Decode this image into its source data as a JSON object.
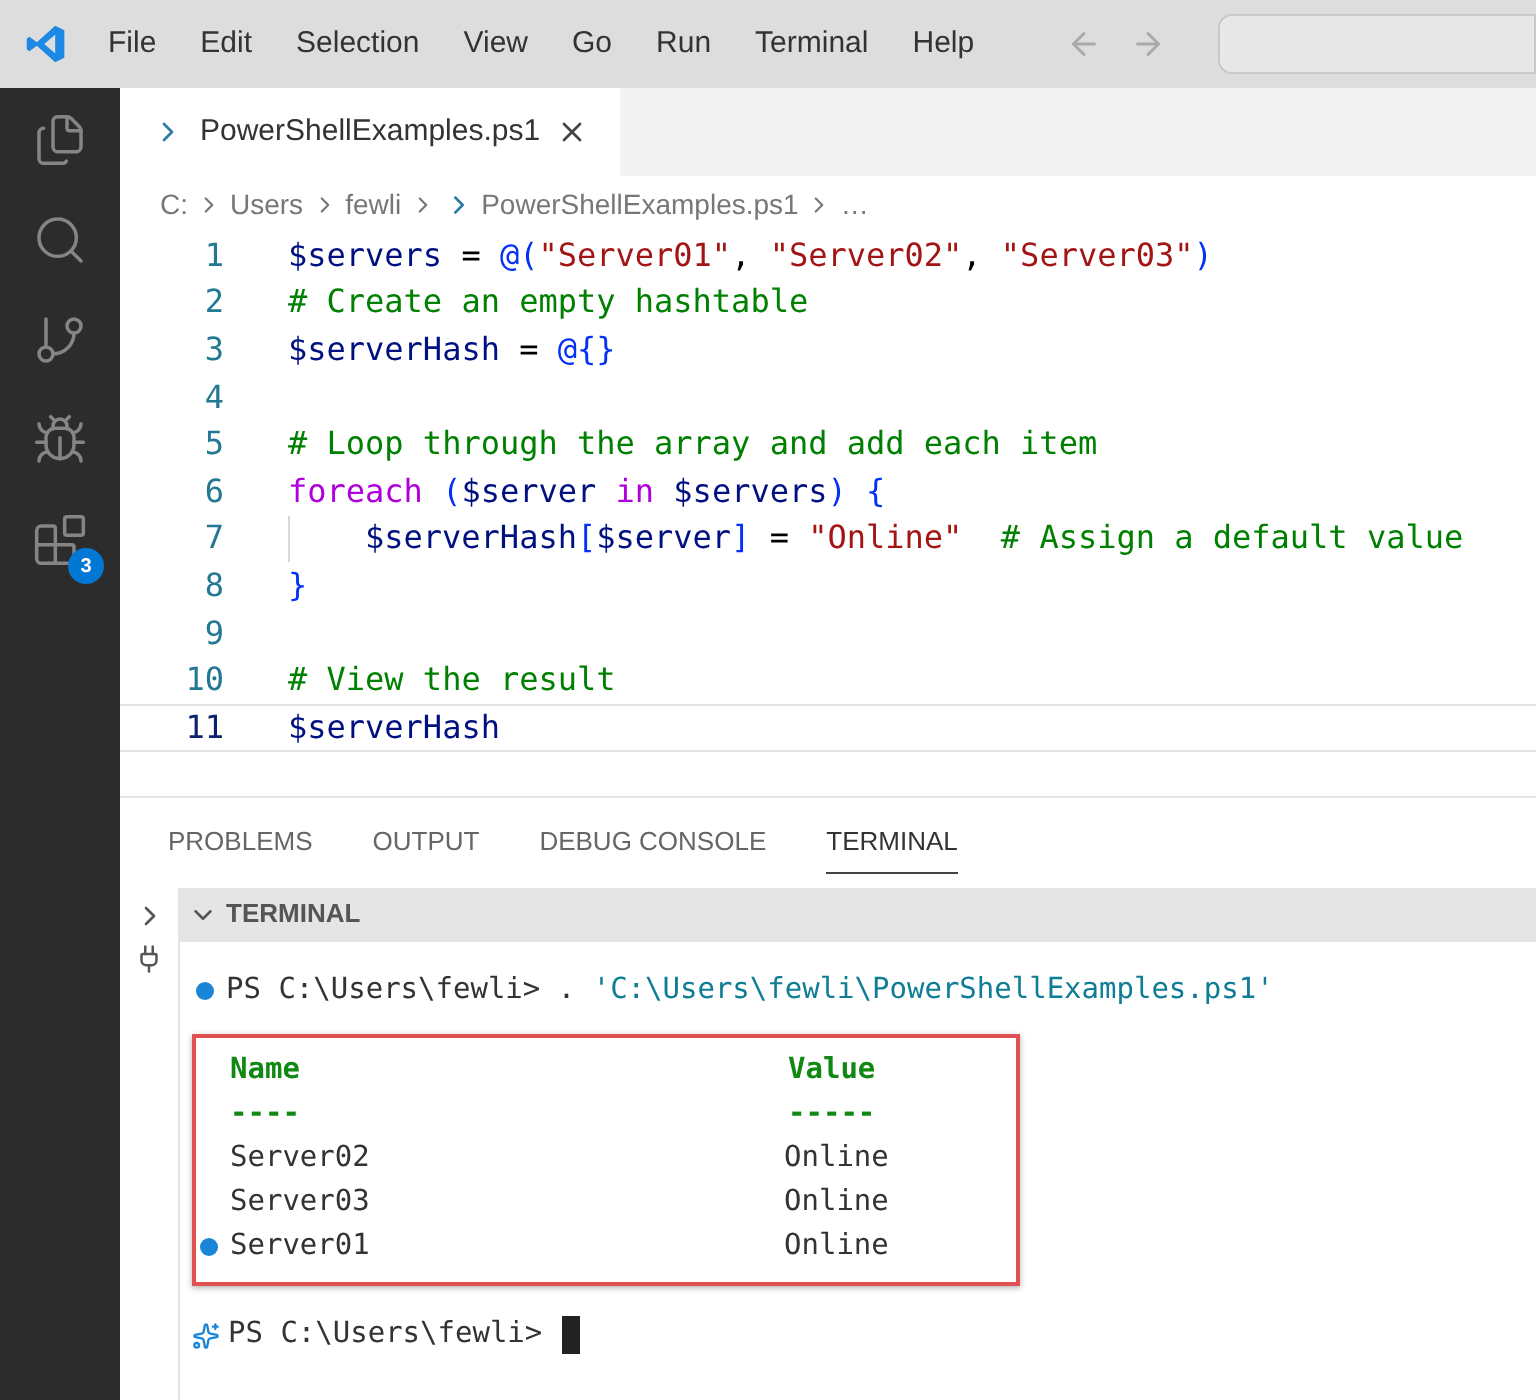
{
  "menu_bar": {
    "items": [
      "File",
      "Edit",
      "Selection",
      "View",
      "Go",
      "Run",
      "Terminal",
      "Help"
    ]
  },
  "activity_bar": {
    "items": [
      {
        "kind": "files",
        "selected": false
      },
      {
        "kind": "search",
        "selected": false
      },
      {
        "kind": "source-control",
        "selected": false
      },
      {
        "kind": "debug",
        "selected": false
      },
      {
        "kind": "extensions",
        "selected": false,
        "badge": "3"
      }
    ]
  },
  "tabs": [
    {
      "label": "PowerShellExamples.ps1",
      "selected": true
    }
  ],
  "breadcrumb": [
    {
      "kind": "folder",
      "label": "C:"
    },
    {
      "kind": "folder",
      "label": "Users"
    },
    {
      "kind": "folder",
      "label": "fewli"
    },
    {
      "kind": "file",
      "label": "PowerShellExamples.ps1"
    },
    {
      "kind": "folder",
      "label": "…"
    }
  ],
  "editor": {
    "lines": [
      {
        "number": "1",
        "current": false,
        "tokens": [
          {
            "kind": "variable",
            "text": "$servers"
          },
          {
            "kind": "plain",
            "text": " = "
          },
          {
            "kind": "bracket",
            "text": "@("
          },
          {
            "kind": "string",
            "text": "\"Server01\""
          },
          {
            "kind": "plain",
            "text": ", "
          },
          {
            "kind": "string",
            "text": "\"Server02\""
          },
          {
            "kind": "plain",
            "text": ", "
          },
          {
            "kind": "string",
            "text": "\"Server03\""
          },
          {
            "kind": "bracket",
            "text": ")"
          }
        ]
      },
      {
        "number": "2",
        "current": false,
        "tokens": [
          {
            "kind": "comment",
            "text": "# Create an empty hashtable"
          }
        ]
      },
      {
        "number": "3",
        "current": false,
        "tokens": [
          {
            "kind": "variable",
            "text": "$serverHash"
          },
          {
            "kind": "plain",
            "text": " = "
          },
          {
            "kind": "bracket",
            "text": "@{}"
          }
        ]
      },
      {
        "number": "4",
        "current": false
      },
      {
        "number": "5",
        "current": false,
        "tokens": [
          {
            "kind": "comment",
            "text": "# Loop through the array and add each item"
          }
        ]
      },
      {
        "number": "6",
        "current": false,
        "tokens": [
          {
            "kind": "keyword",
            "text": "foreach "
          },
          {
            "kind": "bracket",
            "text": "("
          },
          {
            "kind": "variable",
            "text": "$server "
          },
          {
            "kind": "keyword",
            "text": "in "
          },
          {
            "kind": "variable",
            "text": "$servers"
          },
          {
            "kind": "bracket",
            "text": ") {"
          }
        ]
      },
      {
        "number": "7",
        "current": false,
        "indented": true,
        "tokens": [
          {
            "kind": "variable",
            "text": "$serverHash"
          },
          {
            "kind": "bracket",
            "text": "["
          },
          {
            "kind": "variable",
            "text": "$server"
          },
          {
            "kind": "bracket",
            "text": "]"
          },
          {
            "kind": "plain",
            "text": " = "
          },
          {
            "kind": "string",
            "text": "\"Online\"  "
          },
          {
            "kind": "comment",
            "text": "# Assign a default value"
          }
        ]
      },
      {
        "number": "8",
        "current": false,
        "tokens": [
          {
            "kind": "bracket",
            "text": "}"
          }
        ]
      },
      {
        "number": "9",
        "current": false
      },
      {
        "number": "10",
        "current": false,
        "tokens": [
          {
            "kind": "comment",
            "text": "# View the result"
          }
        ]
      },
      {
        "number": "11",
        "current": true,
        "tokens": [
          {
            "kind": "variable",
            "text": "$serverHash"
          }
        ]
      }
    ]
  },
  "panel": {
    "tabs": [
      {
        "label": "PROBLEMS",
        "selected": false
      },
      {
        "label": "OUTPUT",
        "selected": false
      },
      {
        "label": "DEBUG CONSOLE",
        "selected": false
      },
      {
        "label": "TERMINAL",
        "selected": true
      }
    ]
  },
  "terminal": {
    "title": "TERMINAL",
    "expanded": true,
    "command": {
      "decorated": true,
      "prompt": "PS C:\\Users\\fewli>",
      "tokens": [
        {
          "kind": "plain",
          "text": " . "
        },
        {
          "kind": "string",
          "text": "'C:\\Users\\fewli\\PowerShellExamples.ps1'"
        }
      ]
    },
    "output": {
      "outlined": true,
      "columns": [
        "Name",
        "Value"
      ],
      "underlines": [
        "----",
        "-----"
      ],
      "rows": [
        {
          "decorated": false,
          "name": "Server02",
          "value": "Online"
        },
        {
          "decorated": false,
          "name": "Server03",
          "value": "Online"
        },
        {
          "decorated": true,
          "name": "Server01",
          "value": "Online"
        }
      ]
    },
    "prompt": {
      "text": "PS C:\\Users\\fewli>"
    }
  }
}
